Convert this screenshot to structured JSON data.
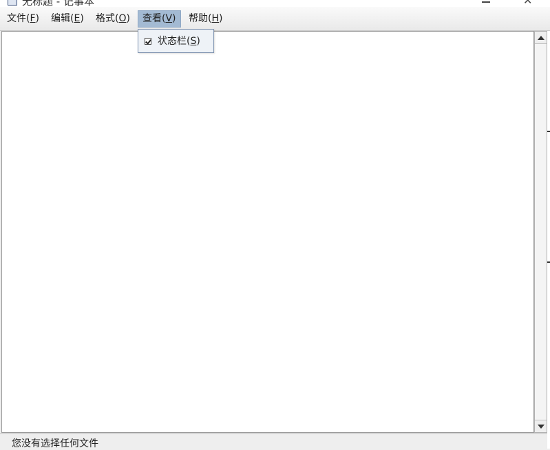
{
  "window": {
    "title": "无标题 - 记事本",
    "minimize_icon": "minimize-icon",
    "close_icon": "close-icon",
    "close_glyph": "✕"
  },
  "menubar": {
    "items": [
      {
        "label": "文件(",
        "mnemonic": "F",
        "suffix": ")"
      },
      {
        "label": "编辑(",
        "mnemonic": "E",
        "suffix": ")"
      },
      {
        "label": "格式(",
        "mnemonic": "O",
        "suffix": ")"
      },
      {
        "label": "查看(",
        "mnemonic": "V",
        "suffix": ")"
      },
      {
        "label": "帮助(",
        "mnemonic": "H",
        "suffix": ")"
      }
    ],
    "active_index": 3
  },
  "view_menu": {
    "items": [
      {
        "label": "状态栏(",
        "mnemonic": "S",
        "suffix": ")",
        "checked": true
      }
    ]
  },
  "editor": {
    "content": ""
  },
  "statusbar": {
    "text": "您没有选择任何文件"
  },
  "colors": {
    "menu_active": "#a3bad3",
    "dropdown_bg": "#eef2f7",
    "editor_bg": "#ffffff"
  }
}
